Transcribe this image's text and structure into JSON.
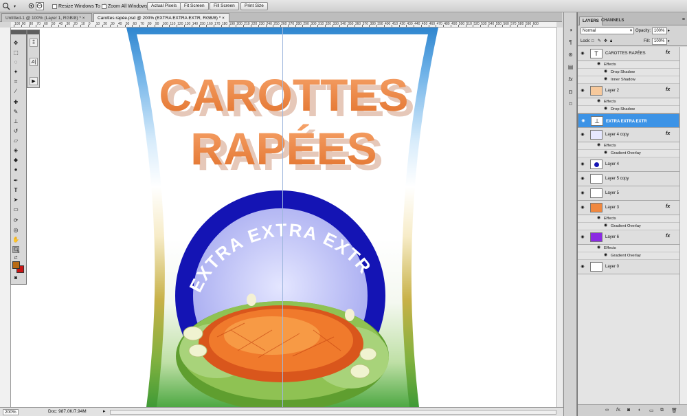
{
  "options_bar": {
    "resize_windows": "Resize Windows To Fit",
    "zoom_all": "Zoom All Windows",
    "actual_pixels": "Actual Pixels",
    "fit_screen": "Fit Screen",
    "fill_screen": "Fill Screen",
    "print_size": "Print Size"
  },
  "doc_tabs": [
    "Untitled-1 @ 100% (Layer 1, RGB/8) *",
    "Carottes rapée.psd @ 200% (EXTRA EXTRA EXTR, RGB/8) *"
  ],
  "ruler_labels": [
    "100",
    "90",
    "80",
    "70",
    "60",
    "50",
    "40",
    "30",
    "20",
    "10",
    "0",
    "10",
    "20",
    "30",
    "40",
    "50",
    "60",
    "70",
    "80",
    "90",
    "100",
    "110",
    "120",
    "130",
    "140",
    "150",
    "160",
    "170",
    "180",
    "190",
    "200",
    "210",
    "220",
    "230",
    "240",
    "250",
    "260",
    "270",
    "280",
    "290",
    "300",
    "310",
    "320",
    "330",
    "340",
    "350",
    "360",
    "370",
    "380",
    "390",
    "400",
    "410",
    "420",
    "430",
    "440",
    "450",
    "460",
    "470",
    "480",
    "490",
    "500",
    "510",
    "520",
    "530",
    "540",
    "550",
    "560",
    "570",
    "580",
    "590",
    "600"
  ],
  "artwork": {
    "title_line1": "CAROTTES",
    "title_line2": "RAPÉES",
    "arc_text": "EXTRA EXTRA EXTR"
  },
  "status": {
    "zoom": "200%",
    "doc": "Doc: 987.0K/7.94M"
  },
  "panel": {
    "tab_layers": "LAYERS",
    "tab_channels": "CHANNELS",
    "blend_mode": "Normal",
    "opacity_label": "Opacity:",
    "opacity_value": "100%",
    "lock_label": "Lock:",
    "fill_label": "Fill:",
    "fill_value": "100%",
    "layers": [
      {
        "name": "CAROTTES RAPÉES",
        "fx": "fx",
        "effects_label": "Effects",
        "effects": [
          "Drop Shadow",
          "Inner Shadow"
        ]
      },
      {
        "name": "Layer 2",
        "fx": "fx",
        "effects_label": "Effects",
        "effects": [
          "Drop Shadow"
        ]
      },
      {
        "name": "EXTRA EXTRA EXTR"
      },
      {
        "name": "Layer 4 copy",
        "fx": "fx",
        "effects_label": "Effects",
        "effects": [
          "Gradient Overlay"
        ]
      },
      {
        "name": "Layer 4"
      },
      {
        "name": "Layer 5 copy"
      },
      {
        "name": "Layer 5"
      },
      {
        "name": "Layer 3",
        "fx": "fx",
        "effects_label": "Effects",
        "effects": [
          "Gradient Overlay"
        ]
      },
      {
        "name": "Layer 6",
        "fx": "fx",
        "effects_label": "Effects",
        "effects": [
          "Gradient Overlay"
        ]
      },
      {
        "name": "Layer 0"
      }
    ]
  },
  "colors": {
    "title_orange": "#f0883f",
    "arc_blue": "#1414b4",
    "selection_blue": "#3c93e6",
    "foreground_swatch": "#b86a14",
    "background_swatch": "#c81414"
  }
}
